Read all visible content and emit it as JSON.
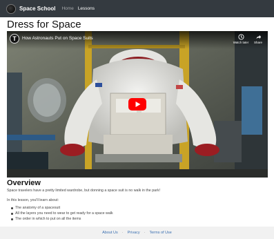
{
  "navbar": {
    "brand": "Space School",
    "links": [
      {
        "label": "Home",
        "active": false
      },
      {
        "label": "Lessons",
        "active": true
      }
    ]
  },
  "page": {
    "title": "Dress for Space"
  },
  "video": {
    "channel_initial": "T",
    "title": "How Astronauts Put on Space Suits",
    "watch_later": "Watch later",
    "share": "Share",
    "play_icon": "youtube-play-icon"
  },
  "overview": {
    "heading": "Overview",
    "intro": "Space travelers have a pretty limited wardrobe, but donning a space suit is no walk in the park!",
    "lead": "In this lesson, you'll learn about:",
    "items": [
      "The anatomy of a spacesuit",
      "All the layers you need to wear to get ready for a space walk",
      "The order in which to put on all the items"
    ]
  },
  "footer": {
    "links": [
      "About Us",
      "Privacy",
      "Terms of Use"
    ],
    "separator": "·"
  },
  "colors": {
    "navbar_bg": "#343a40",
    "youtube_red": "#ff0000",
    "link_blue": "#3a6fb0"
  }
}
